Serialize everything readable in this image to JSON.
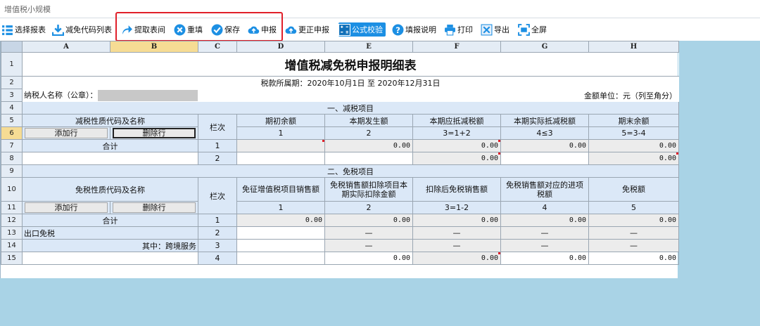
{
  "window": {
    "title": "增值税小规模"
  },
  "toolbar": {
    "select_form": "选择报表",
    "code_list": "减免代码列表",
    "fetch_period": "提取表间",
    "refill": "重填",
    "save": "保存",
    "declare": "申报",
    "correct_declare": "更正申报",
    "formula_check": "公式校验",
    "fill_help": "填报说明",
    "print": "打印",
    "export": "导出",
    "fullscreen": "全屏"
  },
  "colors": {
    "accent": "#1c8fe3",
    "highlight": "#e0202a",
    "selected": "#f6dc94"
  },
  "columns": [
    "A",
    "B",
    "C",
    "D",
    "E",
    "F",
    "G",
    "H"
  ],
  "rows": [
    "1",
    "2",
    "3",
    "4",
    "5",
    "6",
    "7",
    "8",
    "9",
    "10",
    "11",
    "12",
    "13",
    "14",
    "15"
  ],
  "sheet": {
    "title": "增值税减免税申报明细表",
    "period_label": "税款所属期：",
    "period_value": "2020年10月1日 至 2020年12月31日",
    "taxpayer_label": "纳税人名称（公章）：",
    "unit_label": "金额单位：元（列至角分）",
    "sec1": {
      "title": "一、减税项目",
      "name_header": "减税性质代码及名称",
      "line_header": "栏次",
      "headers": [
        "期初余额",
        "本期发生额",
        "本期应抵减税额",
        "本期实际抵减税额",
        "期末余额"
      ],
      "col_nums": [
        "1",
        "2",
        "3=1+2",
        "4≤3",
        "5=3-4"
      ],
      "add_row": "添加行",
      "del_row": "删除行",
      "total": "合计",
      "rows": [
        {
          "line": "1",
          "vals": [
            "",
            "0.00",
            "0.00",
            "0.00",
            "0.00"
          ]
        },
        {
          "line": "2",
          "vals": [
            "",
            "",
            "0.00",
            "",
            "0.00"
          ]
        }
      ]
    },
    "sec2": {
      "title": "二、免税项目",
      "name_header": "免税性质代码及名称",
      "line_header": "栏次",
      "headers": [
        "免征增值税项目销售额",
        "免税销售额扣除项目本期实际扣除金额",
        "扣除后免税销售额",
        "免税销售额对应的进项税额",
        "免税额"
      ],
      "col_nums": [
        "1",
        "2",
        "3=1-2",
        "4",
        "5"
      ],
      "add_row": "添加行",
      "del_row": "删除行",
      "total": "合计",
      "export_exempt": "出口免税",
      "cross_border": "其中：跨境服务",
      "dash": "—",
      "rows": [
        {
          "line": "1",
          "vals": [
            "0.00",
            "0.00",
            "0.00",
            "0.00",
            "0.00"
          ]
        },
        {
          "line": "2",
          "vals": [
            "",
            "—",
            "—",
            "—",
            "—"
          ]
        },
        {
          "line": "3",
          "vals": [
            "",
            "—",
            "—",
            "—",
            "—"
          ]
        },
        {
          "line": "4",
          "vals": [
            "",
            "0.00",
            "0.00",
            "0.00",
            "0.00"
          ]
        }
      ]
    }
  }
}
